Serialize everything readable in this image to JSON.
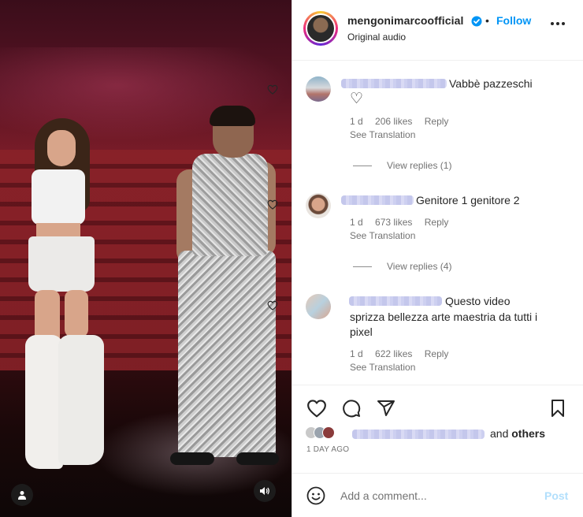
{
  "header": {
    "username": "mengonimarcoofficial",
    "separator": "•",
    "follow_label": "Follow",
    "subtitle": "Original audio"
  },
  "comments": [
    {
      "text": "Vabbè pazzeschi",
      "emoji_line": "♡",
      "time": "1 d",
      "likes": "206 likes",
      "reply": "Reply",
      "translation": "See Translation",
      "view_replies": "View replies (1)"
    },
    {
      "text": "Genitore 1 genitore 2",
      "time": "1 d",
      "likes": "673 likes",
      "reply": "Reply",
      "translation": "See Translation",
      "view_replies": "View replies (4)"
    },
    {
      "text": "Questo video sprizza bellezza arte maestria da tutti i pixel",
      "time": "1 d",
      "likes": "622 likes",
      "reply": "Reply",
      "translation": "See Translation"
    }
  ],
  "likes_summary": {
    "and": "and",
    "others": "others"
  },
  "post_date": "1 DAY AGO",
  "composer": {
    "placeholder": "Add a comment...",
    "post_label": "Post"
  },
  "colors": {
    "accent": "#0095f6",
    "post_disabled": "#b2dffc",
    "secondary_text": "#737373"
  }
}
